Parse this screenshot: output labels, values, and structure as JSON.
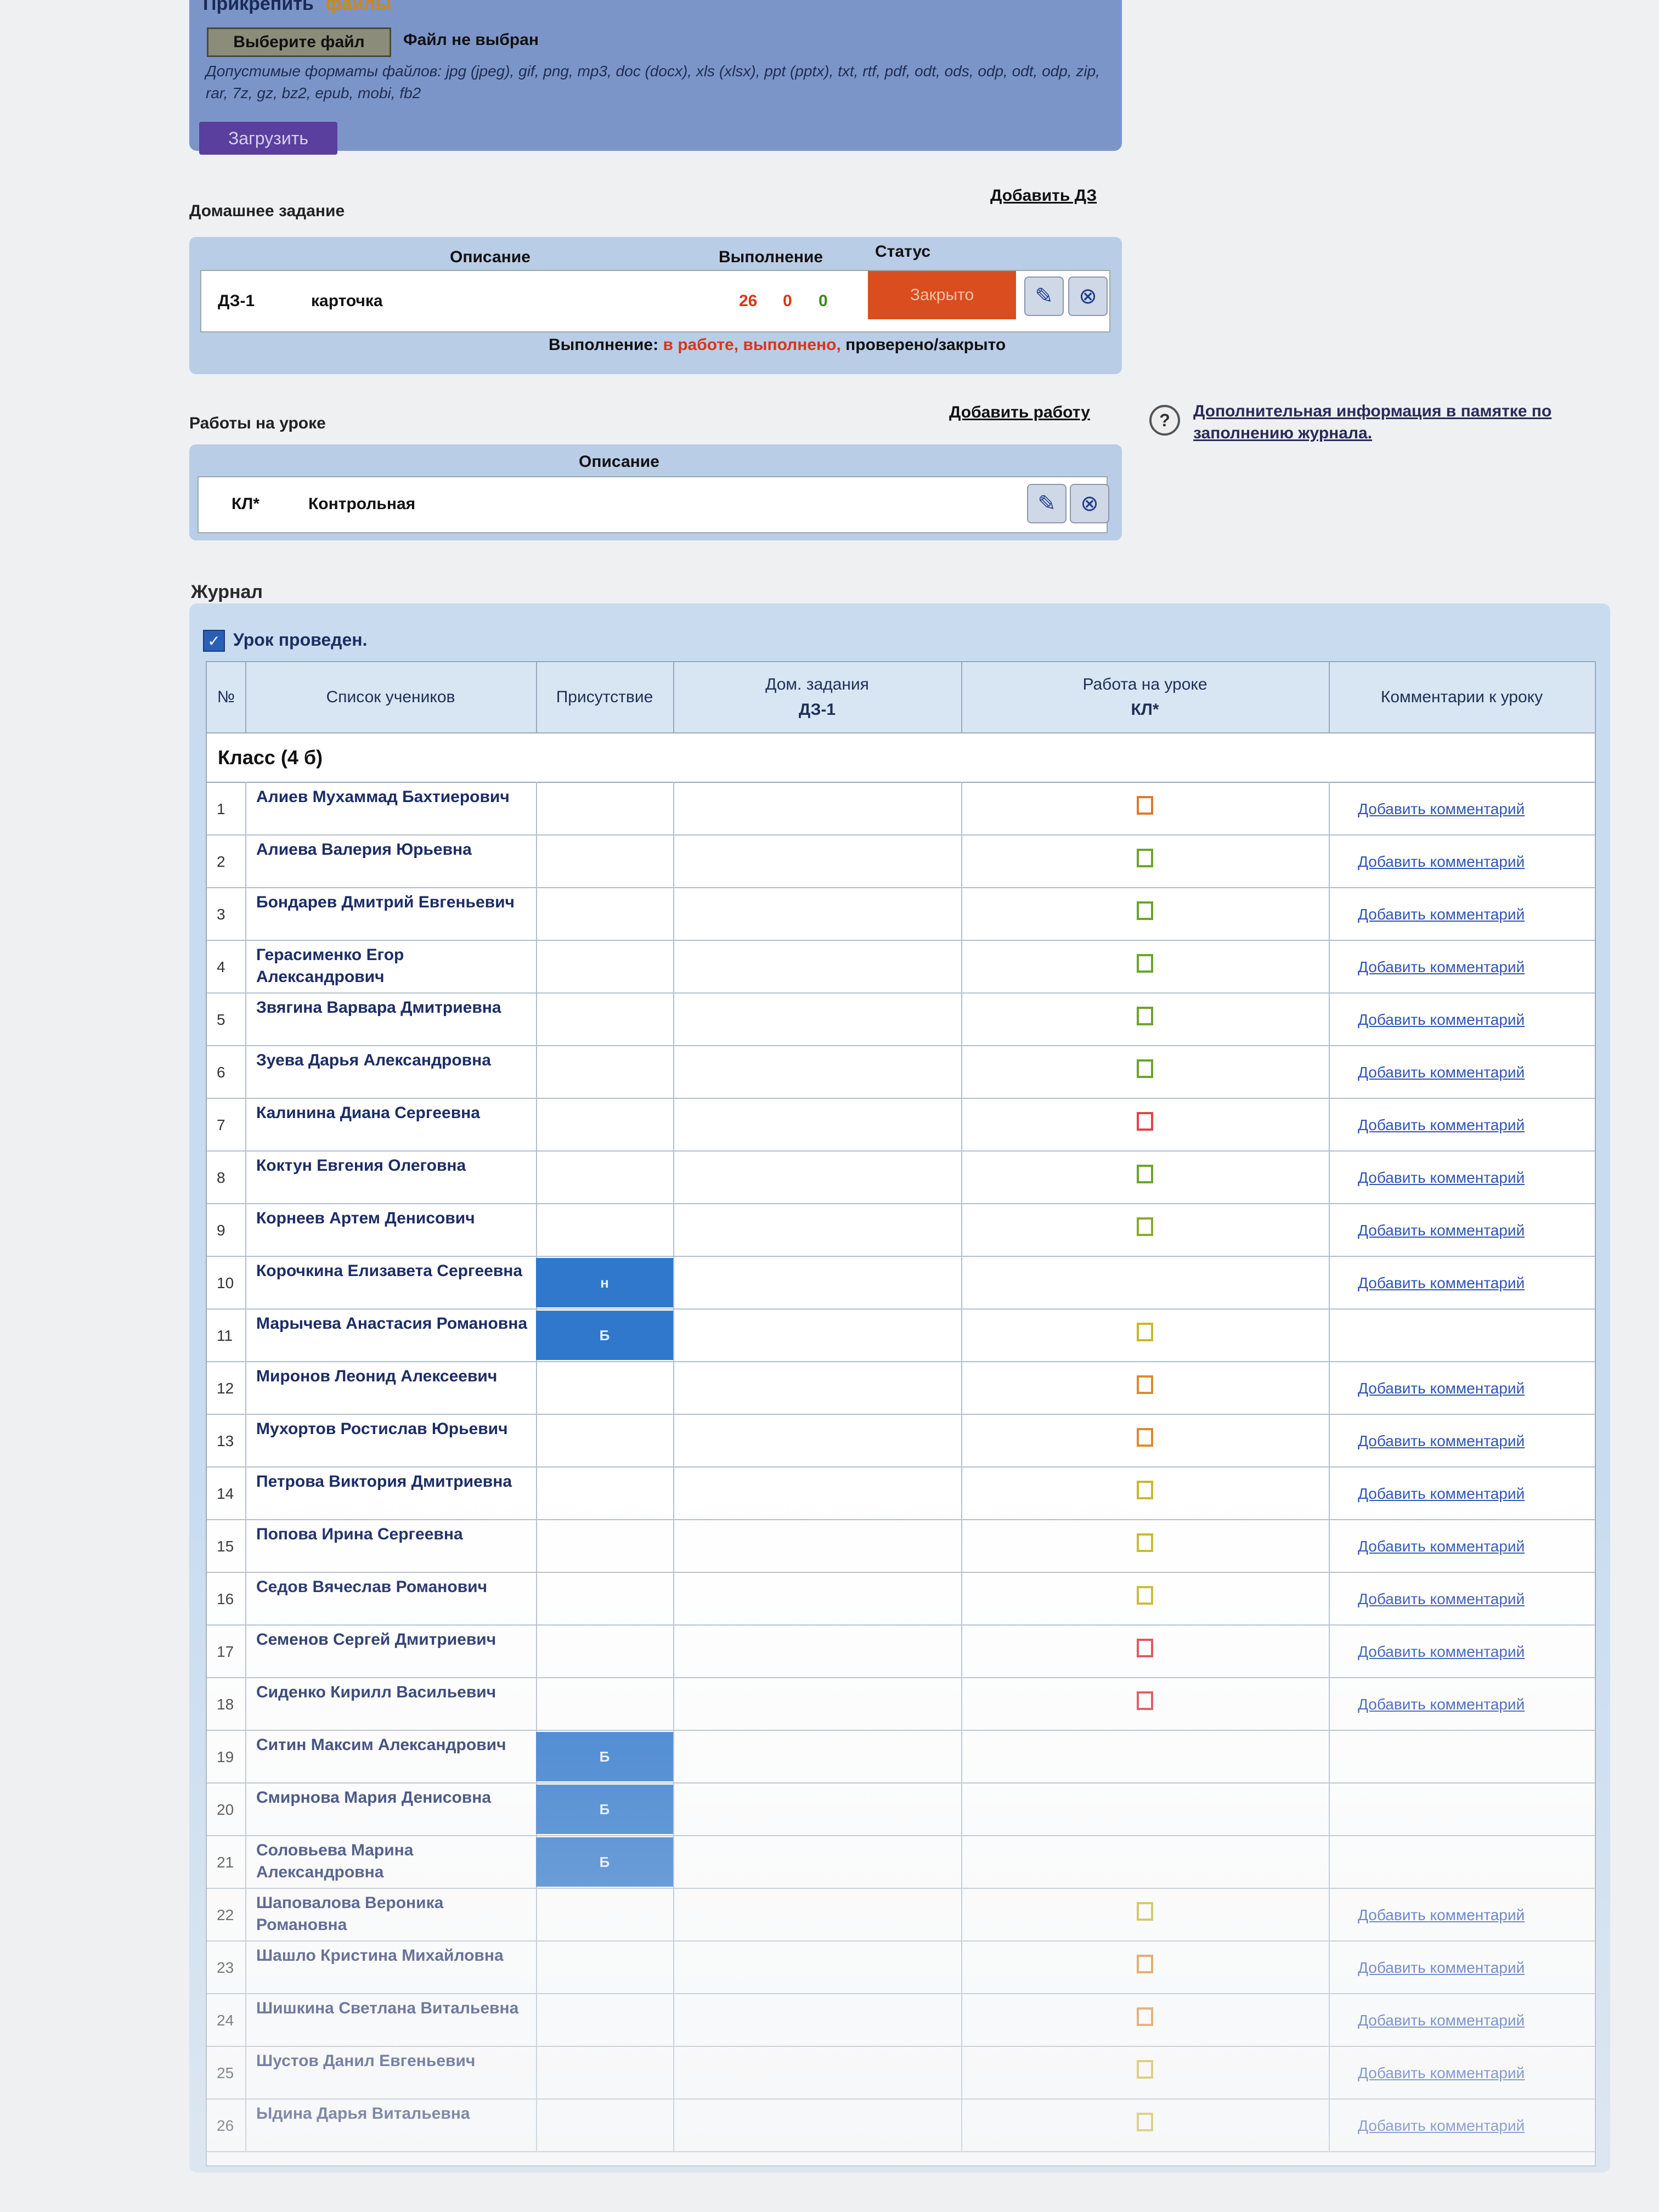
{
  "upload": {
    "attach_label": "Прикрепить",
    "attach_link": "файлы",
    "choose_button": "Выберите файл",
    "no_file": "Файл не выбран",
    "formats": "Допустимые форматы файлов: jpg (jpeg), gif, png, mp3, doc (docx), xls (xlsx), ppt (pptx), txt, rtf, pdf, odt, ods, odp, odt, odp, zip, rar, 7z, gz, bz2, epub, mobi, fb2",
    "upload_button": "Загрузить"
  },
  "homework": {
    "title": "Домашнее задание",
    "add_link": "Добавить ДЗ",
    "col_description": "Описание",
    "col_done": "Выполнение",
    "col_status": "Статус",
    "rows": [
      {
        "code": "ДЗ-1",
        "description": "карточка",
        "in_work": "26",
        "done": "0",
        "checked": "0",
        "status": "Закрыто"
      }
    ],
    "legend_prefix": "Выполнение:",
    "legend_red": "в работе, выполнено,",
    "legend_suffix": "проверено/закрыто"
  },
  "classwork": {
    "title": "Работы на уроке",
    "add_link": "Добавить работу",
    "col_description": "Описание",
    "rows": [
      {
        "code": "КЛ*",
        "description": "Контрольная"
      }
    ]
  },
  "info": {
    "icon": "?",
    "text_prefix": "Дополнительная информация",
    "text_link": "в памятке по заполнению журнала."
  },
  "journal": {
    "title": "Журнал",
    "lesson_done": "Урок проведен.",
    "col_num": "№",
    "col_students": "Список учеников",
    "col_presence": "Присутствие",
    "col_homework": "Дом. задания",
    "col_homework_sub": "ДЗ-1",
    "col_classwork": "Работа на уроке",
    "col_classwork_sub": "КЛ*",
    "col_comments": "Комментарии к уроку",
    "class_label": "Класс (4 б)",
    "comment_link": "Добавить комментарий",
    "students": [
      {
        "n": "1",
        "name": "Алиев Мухаммад Бахтиерович",
        "absent": "",
        "mark_color": "#e07a2a",
        "comment": true
      },
      {
        "n": "2",
        "name": "Алиева Валерия Юрьевна",
        "absent": "",
        "mark_color": "#6aa52a",
        "comment": true
      },
      {
        "n": "3",
        "name": "Бондарев Дмитрий Евгеньевич",
        "absent": "",
        "mark_color": "#6aa52a",
        "comment": true
      },
      {
        "n": "4",
        "name": "Герасименко Егор Александрович",
        "absent": "",
        "mark_color": "#6aa52a",
        "comment": true
      },
      {
        "n": "5",
        "name": "Звягина Варвара Дмитриевна",
        "absent": "",
        "mark_color": "#6aa52a",
        "comment": true
      },
      {
        "n": "6",
        "name": "Зуева Дарья Александровна",
        "absent": "",
        "mark_color": "#6aa52a",
        "comment": true
      },
      {
        "n": "7",
        "name": "Калинина Диана Сергеевна",
        "absent": "",
        "mark_color": "#e0444a",
        "comment": true
      },
      {
        "n": "8",
        "name": "Коктун Евгения Олеговна",
        "absent": "",
        "mark_color": "#6aa52a",
        "comment": true
      },
      {
        "n": "9",
        "name": "Корнеев Артем Денисович",
        "absent": "",
        "mark_color": "#8aaa2a",
        "comment": true
      },
      {
        "n": "10",
        "name": "Корочкина Елизавета Сергеевна",
        "absent": "н",
        "mark_color": "",
        "comment": true
      },
      {
        "n": "11",
        "name": "Марычева Анастасия Романовна",
        "absent": "Б",
        "mark_color": "#c9b82a",
        "comment": false
      },
      {
        "n": "12",
        "name": "Миронов Леонид Алексеевич",
        "absent": "",
        "mark_color": "#e08a2a",
        "comment": true
      },
      {
        "n": "13",
        "name": "Мухортов Ростислав Юрьевич",
        "absent": "",
        "mark_color": "#e08a2a",
        "comment": true
      },
      {
        "n": "14",
        "name": "Петрова Виктория Дмитриевна",
        "absent": "",
        "mark_color": "#c9b82a",
        "comment": true
      },
      {
        "n": "15",
        "name": "Попова Ирина Сергеевна",
        "absent": "",
        "mark_color": "#c9b82a",
        "comment": true
      },
      {
        "n": "16",
        "name": "Седов Вячеслав Романович",
        "absent": "",
        "mark_color": "#c9b82a",
        "comment": true
      },
      {
        "n": "17",
        "name": "Семенов Сергей Дмитриевич",
        "absent": "",
        "mark_color": "#e0444a",
        "comment": true
      },
      {
        "n": "18",
        "name": "Сиденко Кирилл Васильевич",
        "absent": "",
        "mark_color": "#e0444a",
        "comment": true
      },
      {
        "n": "19",
        "name": "Ситин Максим Александрович",
        "absent": "Б",
        "mark_color": "",
        "comment": false
      },
      {
        "n": "20",
        "name": "Смирнова Мария Денисовна",
        "absent": "Б",
        "mark_color": "",
        "comment": false
      },
      {
        "n": "21",
        "name": "Соловьева Марина Александровна",
        "absent": "Б",
        "mark_color": "",
        "comment": false
      },
      {
        "n": "22",
        "name": "Шаповалова Вероника Романовна",
        "absent": "",
        "mark_color": "#c9b82a",
        "comment": true
      },
      {
        "n": "23",
        "name": "Шашло Кристина Михайловна",
        "absent": "",
        "mark_color": "#e08a2a",
        "comment": true
      },
      {
        "n": "24",
        "name": "Шишкина Светлана Витальевна",
        "absent": "",
        "mark_color": "#e08a2a",
        "comment": true
      },
      {
        "n": "25",
        "name": "Шустов Данил Евгеньевич",
        "absent": "",
        "mark_color": "#c9b82a",
        "comment": true
      },
      {
        "n": "26",
        "name": "Ыдина Дарья Витальевна",
        "absent": "",
        "mark_color": "#c9b82a",
        "comment": true
      }
    ]
  }
}
